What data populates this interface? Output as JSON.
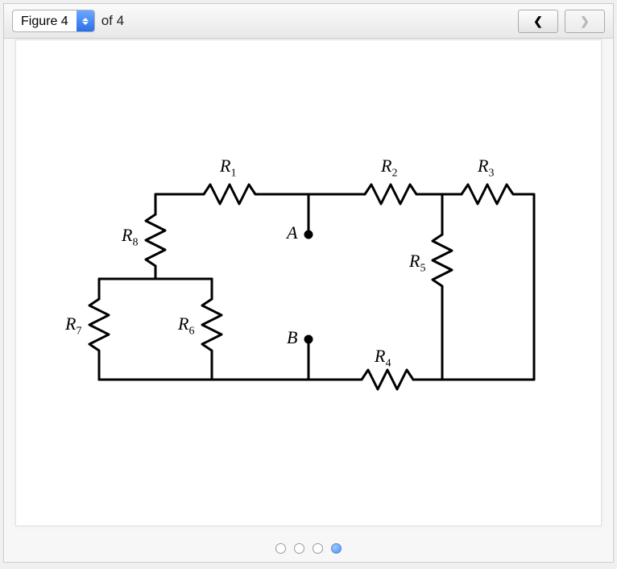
{
  "toolbar": {
    "figure_label": "Figure 4",
    "of_text": "of 4",
    "prev_glyph": "❮",
    "next_glyph": "❯"
  },
  "pager": {
    "count": 4,
    "active_index": 3
  },
  "circuit": {
    "labels": {
      "R1": "R",
      "R1_sub": "1",
      "R2": "R",
      "R2_sub": "2",
      "R3": "R",
      "R3_sub": "3",
      "R4": "R",
      "R4_sub": "4",
      "R5": "R",
      "R5_sub": "5",
      "R6": "R",
      "R6_sub": "6",
      "R7": "R",
      "R7_sub": "7",
      "R8": "R",
      "R8_sub": "8",
      "A": "A",
      "B": "B"
    }
  }
}
